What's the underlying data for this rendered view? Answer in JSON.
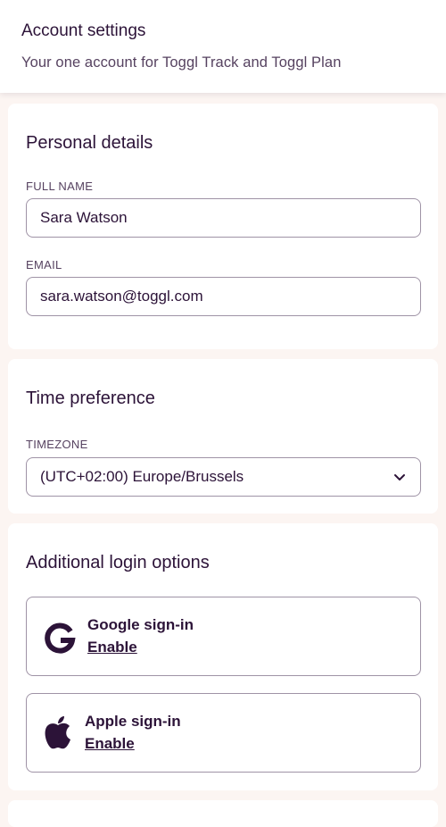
{
  "header": {
    "title": "Account settings",
    "subtitle": "Your one account for Toggl Track and Toggl Plan"
  },
  "personal": {
    "title": "Personal details",
    "full_name_label": "FULL NAME",
    "full_name_value": "Sara Watson",
    "email_label": "EMAIL",
    "email_value": "sara.watson@toggl.com"
  },
  "time": {
    "title": "Time preference",
    "timezone_label": "TIMEZONE",
    "timezone_value": "(UTC+02:00) Europe/Brussels"
  },
  "login": {
    "title": "Additional login options",
    "options": [
      {
        "icon": "google-icon",
        "name": "Google sign-in",
        "action": "Enable"
      },
      {
        "icon": "apple-icon",
        "name": "Apple sign-in",
        "action": "Enable"
      }
    ]
  },
  "colors": {
    "text": "#2c1338",
    "muted": "#564260",
    "border": "#9f93a6",
    "background": "#fcf5f2"
  }
}
